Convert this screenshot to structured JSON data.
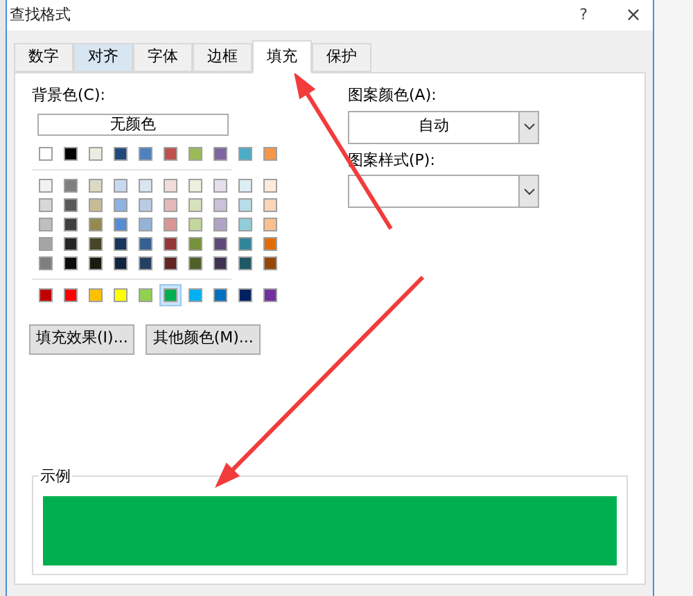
{
  "window": {
    "title": "查找格式",
    "help": "?",
    "close": "×"
  },
  "tabs": [
    {
      "label": "数字",
      "selected": false,
      "hover": false
    },
    {
      "label": "对齐",
      "selected": false,
      "hover": true
    },
    {
      "label": "字体",
      "selected": false,
      "hover": false
    },
    {
      "label": "边框",
      "selected": false,
      "hover": false
    },
    {
      "label": "填充",
      "selected": true,
      "hover": false
    },
    {
      "label": "保护",
      "selected": false,
      "hover": false
    }
  ],
  "background_color": {
    "label": "背景色(C):",
    "no_color_button": "无颜色",
    "theme_row": [
      {
        "color": "#ffffff",
        "selected": false
      },
      {
        "color": "#000000",
        "selected": false
      },
      {
        "color": "#eeece1",
        "selected": false
      },
      {
        "color": "#1f497d",
        "selected": false
      },
      {
        "color": "#4f81bd",
        "selected": false
      },
      {
        "color": "#c0504d",
        "selected": false
      },
      {
        "color": "#9bbb59",
        "selected": false
      },
      {
        "color": "#8064a2",
        "selected": false
      },
      {
        "color": "#4bacc6",
        "selected": false
      },
      {
        "color": "#f79646",
        "selected": false
      }
    ],
    "tint_rows": [
      [
        {
          "color": "#f2f2f2",
          "selected": false
        },
        {
          "color": "#7f7f7f",
          "selected": false
        },
        {
          "color": "#ddd9c3",
          "selected": false
        },
        {
          "color": "#c6d9f0",
          "selected": false
        },
        {
          "color": "#dbe5f1",
          "selected": false
        },
        {
          "color": "#f2dcdb",
          "selected": false
        },
        {
          "color": "#ebf1dd",
          "selected": false
        },
        {
          "color": "#e5e0ec",
          "selected": false
        },
        {
          "color": "#dbeef3",
          "selected": false
        },
        {
          "color": "#fdeada",
          "selected": false
        }
      ],
      [
        {
          "color": "#d8d8d8",
          "selected": false
        },
        {
          "color": "#595959",
          "selected": false
        },
        {
          "color": "#c4bd97",
          "selected": false
        },
        {
          "color": "#8db3e2",
          "selected": false
        },
        {
          "color": "#b8cce4",
          "selected": false
        },
        {
          "color": "#e5b9b7",
          "selected": false
        },
        {
          "color": "#d7e3bc",
          "selected": false
        },
        {
          "color": "#ccc1d9",
          "selected": false
        },
        {
          "color": "#b7dde8",
          "selected": false
        },
        {
          "color": "#fbd5b5",
          "selected": false
        }
      ],
      [
        {
          "color": "#bfbfbf",
          "selected": false
        },
        {
          "color": "#3f3f3f",
          "selected": false
        },
        {
          "color": "#938953",
          "selected": false
        },
        {
          "color": "#548dd4",
          "selected": false
        },
        {
          "color": "#95b3d7",
          "selected": false
        },
        {
          "color": "#d99694",
          "selected": false
        },
        {
          "color": "#c3d69b",
          "selected": false
        },
        {
          "color": "#b2a2c7",
          "selected": false
        },
        {
          "color": "#92cddc",
          "selected": false
        },
        {
          "color": "#fac08f",
          "selected": false
        }
      ],
      [
        {
          "color": "#a5a5a5",
          "selected": false
        },
        {
          "color": "#262626",
          "selected": false
        },
        {
          "color": "#494429",
          "selected": false
        },
        {
          "color": "#17365d",
          "selected": false
        },
        {
          "color": "#366092",
          "selected": false
        },
        {
          "color": "#953734",
          "selected": false
        },
        {
          "color": "#76923c",
          "selected": false
        },
        {
          "color": "#5f497a",
          "selected": false
        },
        {
          "color": "#31859b",
          "selected": false
        },
        {
          "color": "#e36c09",
          "selected": false
        }
      ],
      [
        {
          "color": "#7f7f7f",
          "selected": false
        },
        {
          "color": "#0c0c0c",
          "selected": false
        },
        {
          "color": "#1d1b10",
          "selected": false
        },
        {
          "color": "#0f243e",
          "selected": false
        },
        {
          "color": "#244061",
          "selected": false
        },
        {
          "color": "#632423",
          "selected": false
        },
        {
          "color": "#4f6128",
          "selected": false
        },
        {
          "color": "#3f3151",
          "selected": false
        },
        {
          "color": "#205867",
          "selected": false
        },
        {
          "color": "#974806",
          "selected": false
        }
      ]
    ],
    "standard_row": [
      {
        "color": "#c00000",
        "selected": false
      },
      {
        "color": "#ff0000",
        "selected": false
      },
      {
        "color": "#ffc000",
        "selected": false
      },
      {
        "color": "#ffff00",
        "selected": false
      },
      {
        "color": "#92d050",
        "selected": false
      },
      {
        "color": "#00b050",
        "selected": true
      },
      {
        "color": "#00b0f0",
        "selected": false
      },
      {
        "color": "#0070c0",
        "selected": false
      },
      {
        "color": "#002060",
        "selected": false
      },
      {
        "color": "#7030a0",
        "selected": false
      }
    ],
    "buttons": [
      "填充效果(I)...",
      "其他颜色(M)..."
    ]
  },
  "pattern_color": {
    "label": "图案颜色(A):",
    "value": "自动"
  },
  "pattern_style": {
    "label": "图案样式(P):"
  },
  "sample": {
    "label": "示例",
    "color": "#00b050"
  }
}
